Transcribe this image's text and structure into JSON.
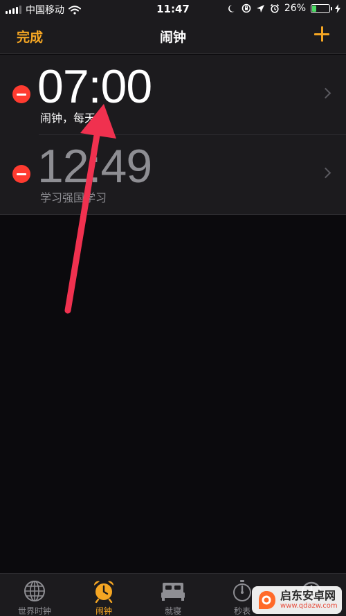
{
  "status_bar": {
    "carrier": "中国移动",
    "time": "11:47",
    "battery": "26%",
    "battery_level": 0.26
  },
  "nav": {
    "done_label": "完成",
    "title": "闹钟",
    "add_icon": "plus-icon"
  },
  "alarms": [
    {
      "time": "07:00",
      "label": "闹钟，每天",
      "enabled": true
    },
    {
      "time": "12:49",
      "label": "学习强国学习",
      "enabled": false
    }
  ],
  "tabs": [
    {
      "label": "世界时钟",
      "icon": "globe-icon"
    },
    {
      "label": "闹钟",
      "icon": "alarm-clock-icon",
      "active": true
    },
    {
      "label": "就寝",
      "icon": "bed-icon"
    },
    {
      "label": "秒表",
      "icon": "stopwatch-icon"
    },
    {
      "label": "",
      "icon": "timer-icon"
    }
  ],
  "watermark": {
    "name": "启东安卓网",
    "url": "www.qdazw.com"
  },
  "colors": {
    "accent": "#f5a623",
    "delete": "#ff3b30",
    "annotation_arrow": "#f0314f",
    "battery": "#4cd964"
  }
}
